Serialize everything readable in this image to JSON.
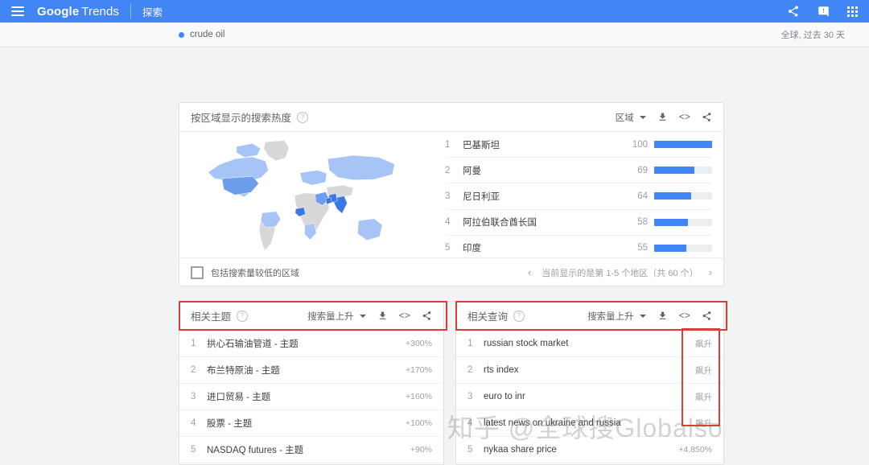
{
  "appbar": {
    "menu_icon": "hamburger-icon",
    "brand_google": "Google",
    "brand_trends": "Trends",
    "nav_explore": "探索",
    "share_icon": "share-icon",
    "feedback_icon": "feedback-icon",
    "apps_icon": "apps-grid-icon",
    "background": "#4285f4"
  },
  "querybar": {
    "term": "crude oil",
    "dot_color": "#4285f4",
    "scope": "全球, 过去 30 天"
  },
  "geo_card": {
    "title": "按区域显示的搜索热度",
    "help": "?",
    "select_label": "区域",
    "download_icon": "download-icon",
    "embed_icon": "embed-code-icon",
    "share_icon": "share-icon",
    "map_alt": "world-map",
    "regions": [
      {
        "rank": "1",
        "name": "巴基斯坦",
        "value": "100",
        "pct": 100
      },
      {
        "rank": "2",
        "name": "阿曼",
        "value": "69",
        "pct": 69
      },
      {
        "rank": "3",
        "name": "尼日利亚",
        "value": "64",
        "pct": 64
      },
      {
        "rank": "4",
        "name": "阿拉伯联合酋长国",
        "value": "58",
        "pct": 58
      },
      {
        "rank": "5",
        "name": "印度",
        "value": "55",
        "pct": 55
      }
    ],
    "checkbox_label": "包括搜索量较低的区域",
    "pager_prev": "‹",
    "pager_text": "当前显示的是第 1-5 个地区（共 60 个）",
    "pager_next": "›"
  },
  "topics_card": {
    "title": "相关主题",
    "help": "?",
    "select_label": "搜索量上升",
    "download_icon": "download-icon",
    "embed_icon": "embed-code-icon",
    "share_icon": "share-icon",
    "items": [
      {
        "rank": "1",
        "name": "拱心石输油管道 - 主题",
        "value": "+300%"
      },
      {
        "rank": "2",
        "name": "布兰特原油 - 主题",
        "value": "+170%"
      },
      {
        "rank": "3",
        "name": "进口贸易 - 主题",
        "value": "+160%"
      },
      {
        "rank": "4",
        "name": "股票 - 主题",
        "value": "+100%"
      },
      {
        "rank": "5",
        "name": "NASDAQ futures - 主题",
        "value": "+90%"
      }
    ]
  },
  "queries_card": {
    "title": "相关查询",
    "help": "?",
    "select_label": "搜索量上升",
    "download_icon": "download-icon",
    "embed_icon": "embed-code-icon",
    "share_icon": "share-icon",
    "items": [
      {
        "rank": "1",
        "name": "russian stock market",
        "value": "飙升"
      },
      {
        "rank": "2",
        "name": "rts index",
        "value": "飙升"
      },
      {
        "rank": "3",
        "name": "euro to inr",
        "value": "飙升"
      },
      {
        "rank": "4",
        "name": "latest news on ukraine and russia",
        "value": "飙升"
      },
      {
        "rank": "5",
        "name": "nykaa share price",
        "value": "+4,850%"
      }
    ]
  },
  "annotations": {
    "color": "#d93f35"
  },
  "watermark": {
    "text": "知乎 @全球搜Globalso"
  }
}
